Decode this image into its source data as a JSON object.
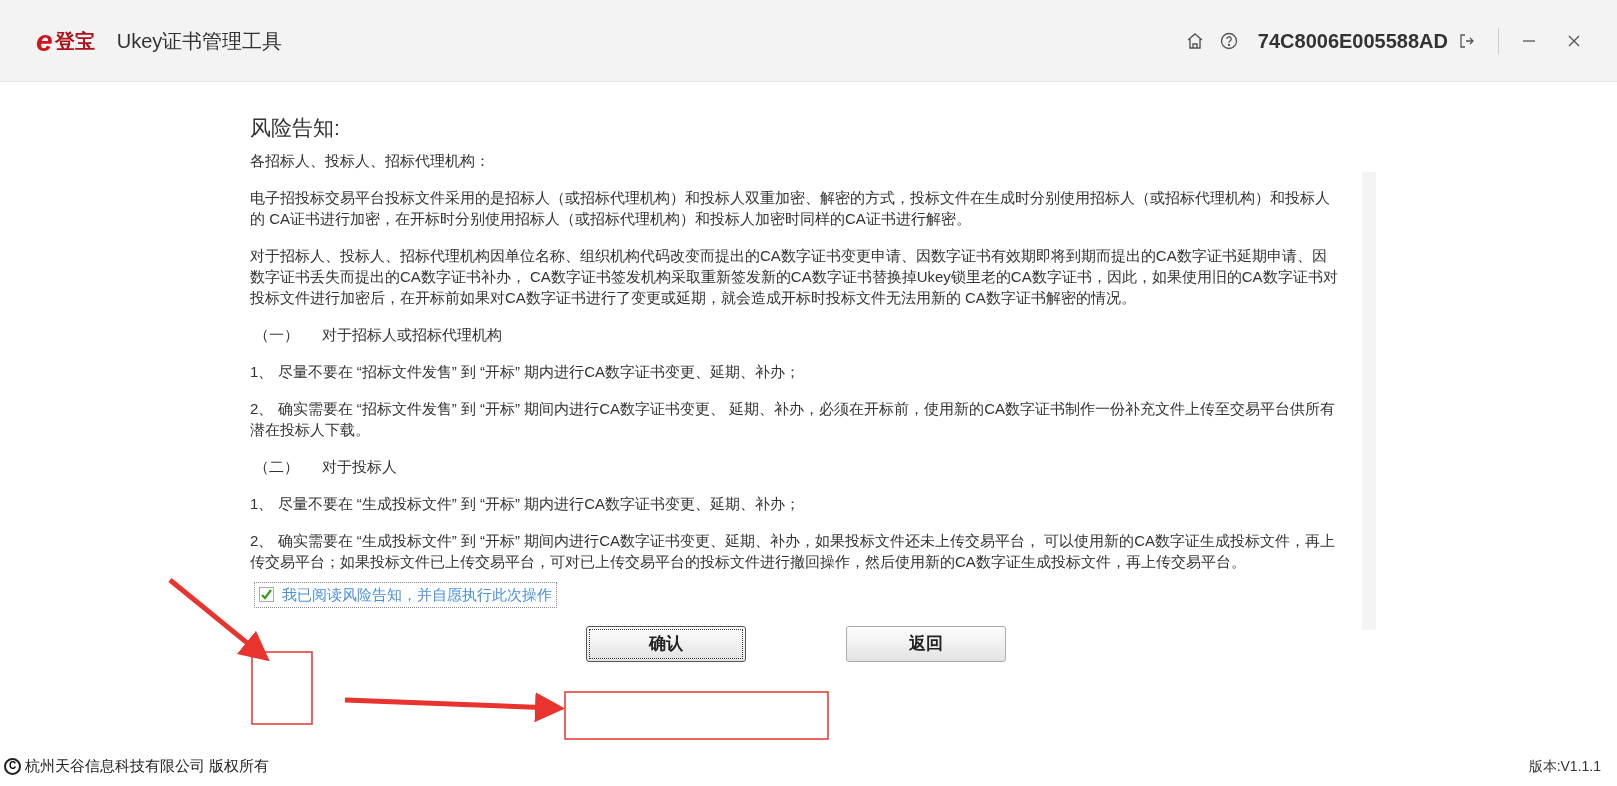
{
  "window": {
    "logo_mark": "e",
    "logo_name": "登宝",
    "title": "Ukey证书管理工具",
    "device_id": "74C8006E005588AD"
  },
  "notice": {
    "heading": "风险告知:",
    "paragraphs": [
      {
        "kind": "text",
        "text": "各招标人、投标人、招标代理机构："
      },
      {
        "kind": "text",
        "text": "电子招投标交易平台投标文件采用的是招标人（或招标代理机构）和投标人双重加密、解密的方式，投标文件在生成时分别使用招标人（或招标代理机构）和投标人的 CA证书进行加密，在开标时分别使用招标人（或招标代理机构）和投标人加密时同样的CA证书进行解密。"
      },
      {
        "kind": "text",
        "text": "对于招标人、投标人、招标代理机构因单位名称、组织机构代码改变而提出的CA数字证书变更申请、因数字证书有效期即将到期而提出的CA数字证书延期申请、因数字证书丢失而提出的CA数字证书补办， CA数字证书签发机构采取重新签发新的CA数字证书替换掉Ukey锁里老的CA数字证书，因此，如果使用旧的CA数字证书对投标文件进行加密后，在开标前如果对CA数字证书进行了变更或延期，就会造成开标时投标文件无法用新的 CA数字证书解密的情况。"
      },
      {
        "kind": "section",
        "number": "（一）",
        "text": "对于招标人或招标代理机构"
      },
      {
        "kind": "text",
        "text": "1、 尽量不要在 “招标文件发售” 到 “开标” 期内进行CA数字证书变更、延期、补办；"
      },
      {
        "kind": "text",
        "text": "2、 确实需要在 “招标文件发售” 到 “开标” 期间内进行CA数字证书变更、 延期、补办，必须在开标前，使用新的CA数字证书制作一份补充文件上传至交易平台供所有潜在投标人下载。"
      },
      {
        "kind": "section",
        "number": "（二）",
        "text": "对于投标人"
      },
      {
        "kind": "text",
        "text": "1、 尽量不要在 “生成投标文件” 到 “开标” 期内进行CA数字证书变更、延期、补办；"
      },
      {
        "kind": "text",
        "text": "2、 确实需要在 “生成投标文件” 到 “开标” 期间内进行CA数字证书变更、延期、补办，如果投标文件还未上传交易平台， 可以使用新的CA数字证生成投标文件，再上传交易平台；如果投标文件已上传交易平台，可对已上传交易平台的投标文件进行撤回操作，然后使用新的CA数字证生成投标文件，再上传交易平台。"
      }
    ]
  },
  "agreement": {
    "label": "我已阅读风险告知，并自愿执行此次操作",
    "checked": true
  },
  "buttons": [
    {
      "label": "确认",
      "focused": true
    },
    {
      "label": "返回",
      "focused": false
    }
  ],
  "footer": {
    "copyright_mark": "C",
    "copyright": "杭州天谷信息科技有限公司 版权所有",
    "version": "版本:V1.1.1"
  }
}
